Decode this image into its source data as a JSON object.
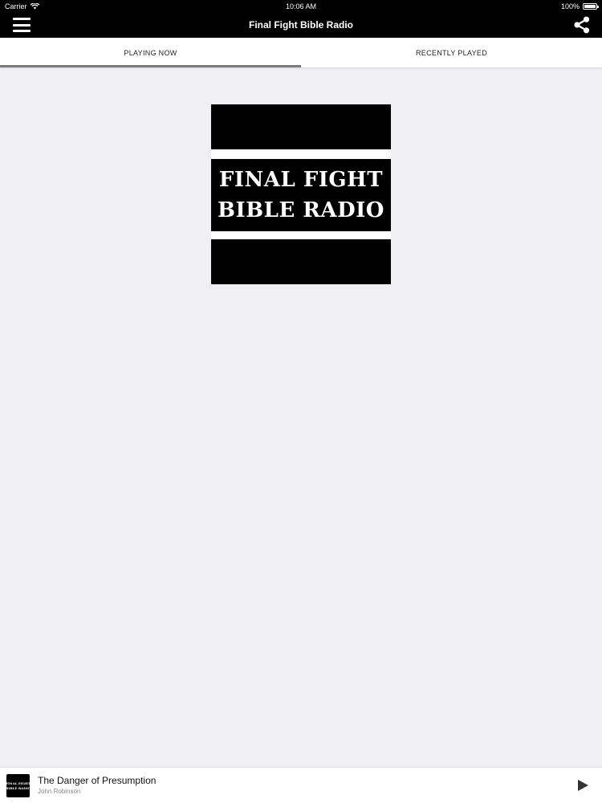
{
  "status_bar": {
    "carrier": "Carrier",
    "time": "10:06 AM",
    "battery": "100%",
    "battery_level": 1.0
  },
  "nav": {
    "title": "Final Fight Bible Radio",
    "left_icon": "hamburger-menu-icon",
    "right_icon": "share-icon"
  },
  "tabs": [
    {
      "label": "PLAYING NOW",
      "active": true
    },
    {
      "label": "RECENTLY PLAYED",
      "active": false
    }
  ],
  "artwork": {
    "line1": "FINAL FIGHT",
    "line2": "BIBLE RADIO"
  },
  "mini_player": {
    "title": "The Danger of Presumption",
    "artist": "John Robinson",
    "thumb_line1": "FINAL FIGHT",
    "thumb_line2": "BIBLE RADIO",
    "play_icon": "play-icon"
  },
  "colors": {
    "bar_background": "#000000",
    "page_background": "#efeff4",
    "tab_indicator": "#7a7a7a"
  }
}
